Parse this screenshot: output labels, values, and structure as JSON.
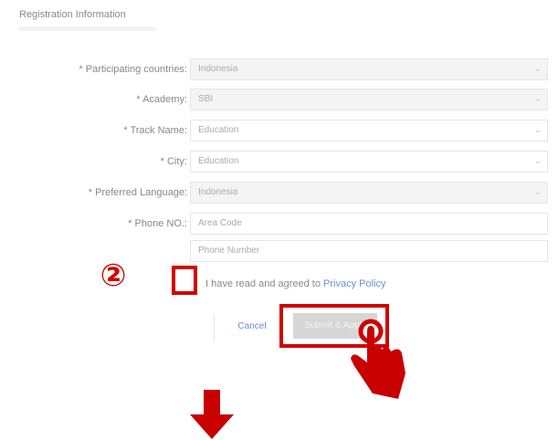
{
  "form": {
    "title": "Registration Information",
    "rows": [
      {
        "label": "* Participating countries:",
        "value": "Indonesia",
        "type": "select"
      },
      {
        "label": "* Academy:",
        "value": "SBI",
        "type": "select"
      },
      {
        "label": "* Track Name:",
        "value": "Education",
        "type": "select"
      },
      {
        "label": "* City:",
        "value": "Education",
        "type": "select"
      },
      {
        "label": "* Preferred Language:",
        "value": "Indonesia",
        "type": "select"
      },
      {
        "label": "* Phone NO.:",
        "value": "Area Code",
        "type": "input"
      },
      {
        "label": "",
        "value": "Phone Number",
        "type": "input"
      }
    ],
    "agreement": {
      "prefix": "I have read and agreed to",
      "link": "Privacy Policy"
    },
    "cancel_label": "Cancel",
    "submit_label": "Submit & Apply"
  },
  "annotation": {
    "step_marker": "②",
    "highlight_color": "#d20000"
  },
  "icons": [
    "chevron-down-icon",
    "pointer-hand-icon",
    "down-arrow-icon"
  ]
}
